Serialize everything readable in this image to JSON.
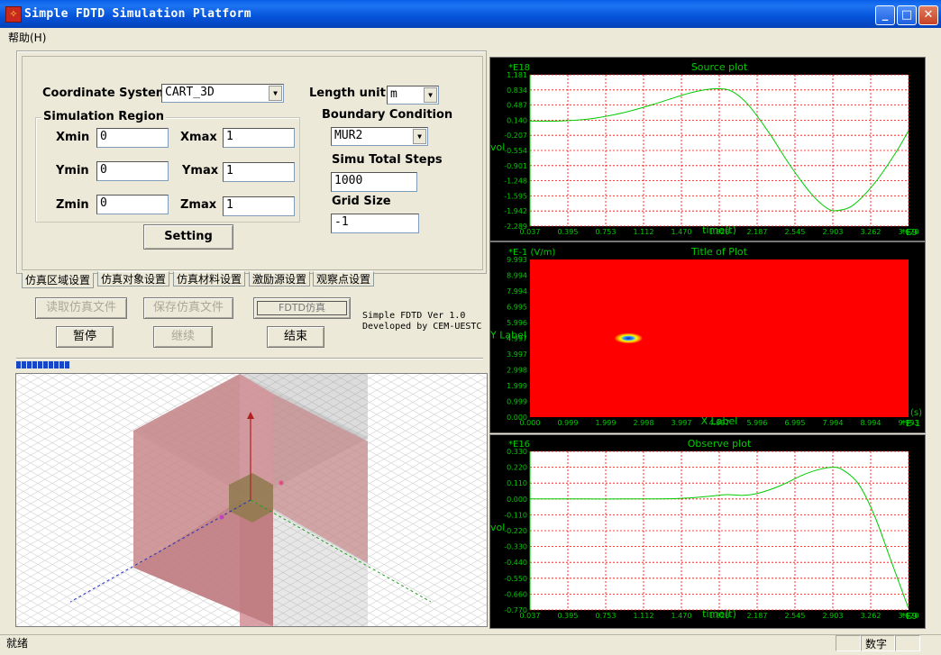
{
  "window": {
    "title": "Simple FDTD Simulation Platform",
    "icon": "app-icon",
    "buttons": {
      "minimize": "_",
      "maximize": "□",
      "close": "✕"
    }
  },
  "menu": {
    "help_label": "帮助(H)"
  },
  "form": {
    "coord_label": "Coordinate  System",
    "coord_value": "CART_3D",
    "length_unit_label": "Length unit",
    "length_unit_value": "m",
    "sim_region_label": "Simulation Region",
    "xmin_label": "Xmin",
    "xmin_value": "0",
    "xmax_label": "Xmax",
    "xmax_value": "1",
    "ymin_label": "Ymin",
    "ymin_value": "0",
    "ymax_label": "Ymax",
    "ymax_value": "1",
    "zmin_label": "Zmin",
    "zmin_value": "0",
    "zmax_label": "Zmax",
    "zmax_value": "1",
    "boundary_label": "Boundary Condition",
    "boundary_value": "MUR2",
    "total_steps_label": "Simu Total Steps",
    "total_steps_value": "1000",
    "grid_size_label": "Grid Size",
    "grid_size_value": "-1",
    "setting_button": "Setting"
  },
  "tabs": [
    "仿真区域设置",
    "仿真对象设置",
    "仿真材料设置",
    "激励源设置",
    "观察点设置"
  ],
  "actions": {
    "read_file": "读取仿真文件",
    "save_file": "保存仿真文件",
    "fdtd_sim": "FDTD仿真",
    "pause": "暂停",
    "continue": "继续",
    "end": "结束"
  },
  "version": {
    "line1": "Simple FDTD Ver 1.0",
    "line2": "Developed by CEM-UESTC"
  },
  "progress": {
    "blocks": 10
  },
  "status": {
    "text": "就绪",
    "numlock": "数字"
  },
  "colors": {
    "plot_bg": "#000000",
    "plot_area": "#ffffff",
    "grid": "#ff0000",
    "trace": "#00cc00",
    "label": "#00cc00",
    "surface": "#ff0000",
    "plate": "#c8878a"
  },
  "chart_data": [
    {
      "type": "line",
      "title": "Source plot",
      "exponent_label_y": "*E18",
      "exponent_label_x": "*E9",
      "xlabel": "time(t)",
      "ylabel": "vol",
      "x_ticks": [
        "0.037",
        "0.395",
        "0.753",
        "1.112",
        "1.470",
        "1.828",
        "2.187",
        "2.545",
        "2.903",
        "3.262",
        "3.620"
      ],
      "y_ticks": [
        "1.181",
        "0.834",
        "0.487",
        "0.140",
        "-0.207",
        "-0.554",
        "-0.901",
        "-1.248",
        "-1.595",
        "-1.942",
        "-2.289"
      ],
      "xlim": [
        0.037,
        3.62
      ],
      "ylim": [
        -2.289,
        1.181
      ],
      "x": [
        0.037,
        0.3,
        0.6,
        0.9,
        1.2,
        1.5,
        1.7,
        1.828,
        1.95,
        2.1,
        2.3,
        2.5,
        2.7,
        2.85,
        2.95,
        3.1,
        3.3,
        3.5,
        3.62
      ],
      "y": [
        0.12,
        0.12,
        0.17,
        0.3,
        0.5,
        0.73,
        0.84,
        0.86,
        0.8,
        0.5,
        -0.15,
        -0.9,
        -1.55,
        -1.88,
        -1.93,
        -1.8,
        -1.3,
        -0.6,
        -0.1
      ]
    },
    {
      "type": "heatmap",
      "title": "Title of Plot",
      "exponent_label_y": "*E-1 (V/m)",
      "exponent_label_x": "*E-1",
      "xlabel": "X Label",
      "ylabel": "Y Label",
      "x_unit": "(s)",
      "x_ticks": [
        "0.000",
        "0.999",
        "1.999",
        "2.998",
        "3.997",
        "4.997",
        "5.996",
        "6.995",
        "7.994",
        "8.994",
        "9.993"
      ],
      "y_ticks": [
        "9.993",
        "8.994",
        "7.994",
        "6.995",
        "5.996",
        "4.997",
        "3.997",
        "2.998",
        "1.999",
        "0.999",
        "0.000"
      ],
      "xlim": [
        0,
        9.993
      ],
      "ylim": [
        0,
        9.993
      ],
      "hotspot": {
        "x": 2.6,
        "y": 5.0
      }
    },
    {
      "type": "line",
      "title": "Observe plot",
      "exponent_label_y": "*E16",
      "exponent_label_x": "*E9",
      "xlabel": "time(t)",
      "ylabel": "vol",
      "x_ticks": [
        "0.037",
        "0.395",
        "0.753",
        "1.112",
        "1.470",
        "1.828",
        "2.187",
        "2.545",
        "2.903",
        "3.262",
        "3.620"
      ],
      "y_ticks": [
        "0.330",
        "0.220",
        "0.110",
        "0.000",
        "-0.110",
        "-0.220",
        "-0.330",
        "-0.440",
        "-0.550",
        "-0.660",
        "-0.770"
      ],
      "xlim": [
        0.037,
        3.62
      ],
      "ylim": [
        -0.77,
        0.33
      ],
      "x": [
        0.037,
        0.5,
        1.0,
        1.4,
        1.6,
        1.75,
        1.9,
        2.05,
        2.2,
        2.4,
        2.6,
        2.75,
        2.9,
        3.0,
        3.15,
        3.3,
        3.45,
        3.62
      ],
      "y": [
        0.0,
        0.0,
        0.0,
        0.002,
        0.01,
        0.02,
        0.03,
        0.025,
        0.04,
        0.09,
        0.16,
        0.2,
        0.22,
        0.2,
        0.1,
        -0.12,
        -0.42,
        -0.76
      ]
    }
  ]
}
